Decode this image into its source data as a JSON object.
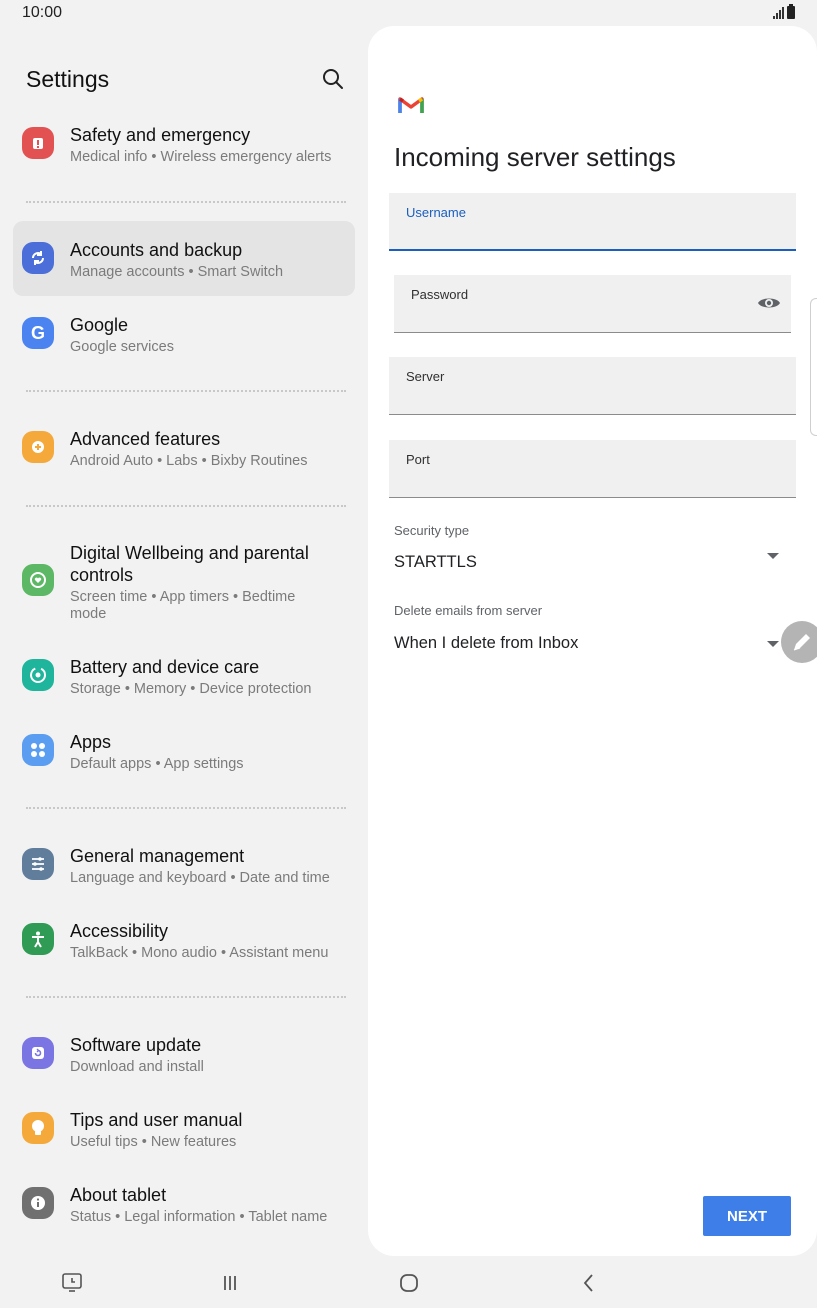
{
  "status": {
    "time": "10:00"
  },
  "settings": {
    "title": "Settings",
    "items": [
      {
        "title": "Safety and emergency",
        "subtitle": "Medical info  •  Wireless emergency alerts",
        "icon": "safety-icon",
        "color": "#e35252"
      },
      {
        "title": "Accounts and backup",
        "subtitle": "Manage accounts  •  Smart Switch",
        "icon": "sync-icon",
        "color": "#4b6ed8"
      },
      {
        "title": "Google",
        "subtitle": "Google services",
        "icon": "google-icon",
        "color": "#4b84f0"
      },
      {
        "title": "Advanced features",
        "subtitle": "Android Auto  •  Labs  •  Bixby Routines",
        "icon": "gear-plus-icon",
        "color": "#f5a93b"
      },
      {
        "title": "Digital Wellbeing and parental",
        "title2": "controls",
        "subtitle": "Screen time  •  App timers  •  Bedtime",
        "subtitle2": "mode",
        "icon": "wellbeing-icon",
        "color": "#5cb865"
      },
      {
        "title": "Battery and device care",
        "subtitle": "Storage  •  Memory  •  Device protection",
        "icon": "device-care-icon",
        "color": "#1fb59c"
      },
      {
        "title": "Apps",
        "subtitle": "Default apps  •  App settings",
        "icon": "apps-icon",
        "color": "#5b9df0"
      },
      {
        "title": "General management",
        "subtitle": "Language and keyboard  •  Date and time",
        "icon": "sliders-icon",
        "color": "#607d9c"
      },
      {
        "title": "Accessibility",
        "subtitle": "TalkBack  •  Mono audio  •  Assistant menu",
        "icon": "accessibility-icon",
        "color": "#2f9b55"
      },
      {
        "title": "Software update",
        "subtitle": "Download and install",
        "icon": "software-update-icon",
        "color": "#7a75e3"
      },
      {
        "title": "Tips and user manual",
        "subtitle": "Useful tips  •  New features",
        "icon": "bulb-icon",
        "color": "#f5a93b"
      },
      {
        "title": "About tablet",
        "subtitle": "Status  •  Legal information  •  Tablet name",
        "icon": "info-icon",
        "color": "#707070"
      }
    ]
  },
  "server": {
    "title": "Incoming server settings",
    "fields": {
      "username": {
        "label": "Username",
        "value": ""
      },
      "password": {
        "label": "Password",
        "value": ""
      },
      "server": {
        "label": "Server",
        "value": ""
      },
      "port": {
        "label": "Port",
        "value": ""
      }
    },
    "security": {
      "label": "Security type",
      "value": "STARTTLS"
    },
    "delete": {
      "label": "Delete emails from server",
      "value": "When I delete from Inbox"
    },
    "next_label": "NEXT"
  },
  "colors": {
    "accent": "#1a5fbf",
    "button": "#3d7ee8"
  }
}
